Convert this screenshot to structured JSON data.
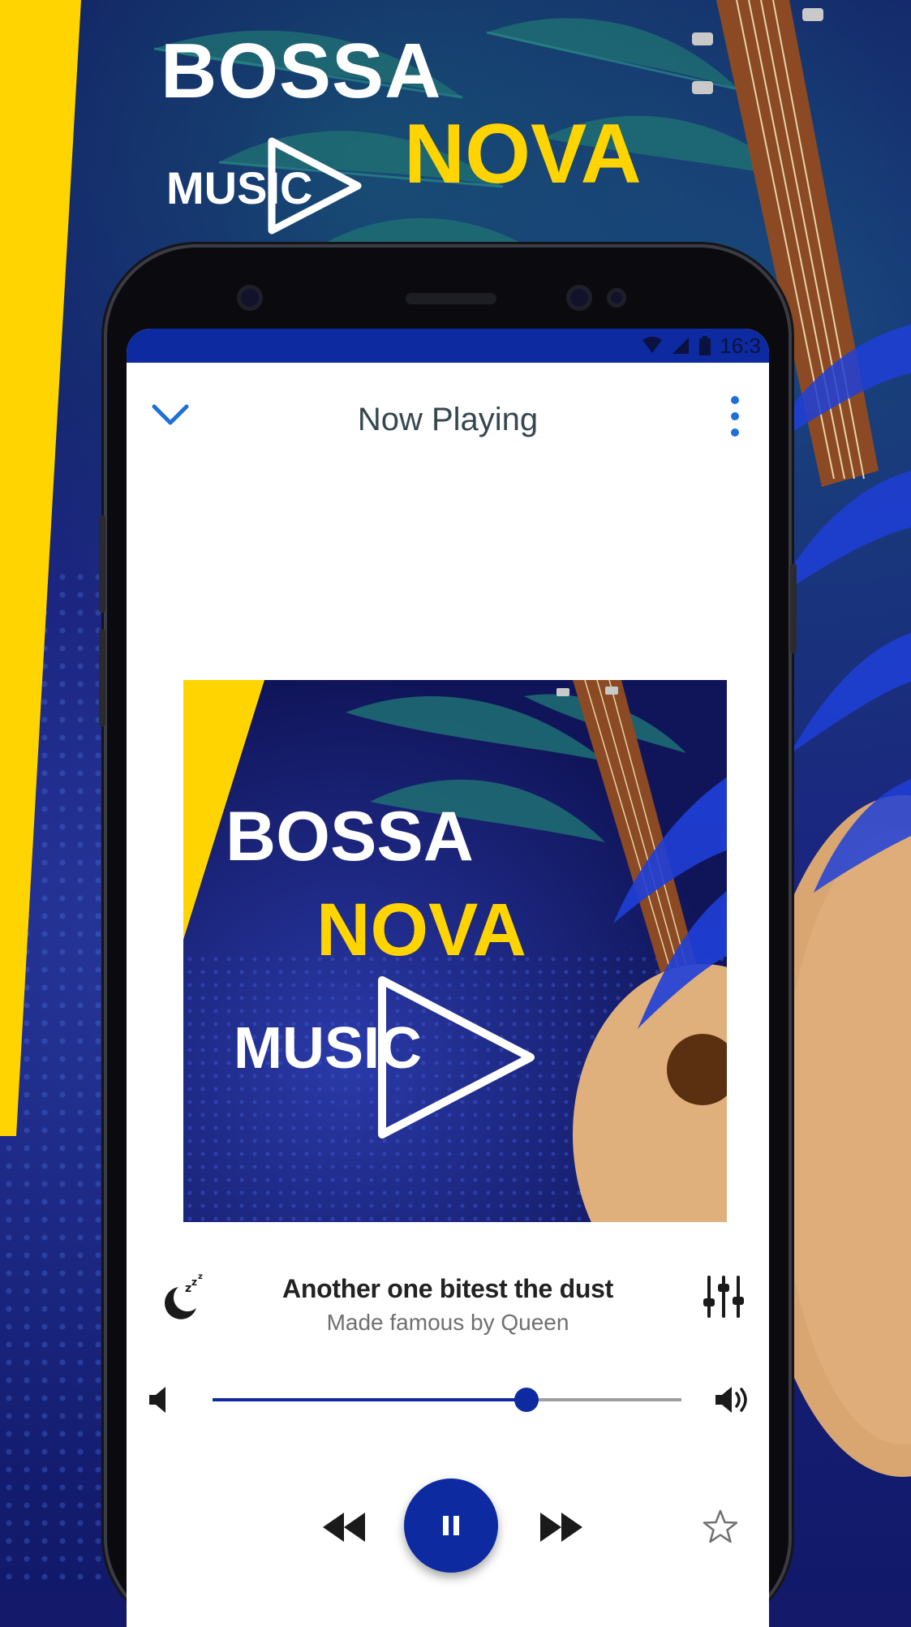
{
  "promo": {
    "title_line1": "BOSSA",
    "title_line2": "NOVA",
    "music_label": "MUSIC"
  },
  "status_bar": {
    "time": "16:3"
  },
  "app_bar": {
    "title": "Now Playing",
    "back_icon": "chevron-down-icon",
    "menu_icon": "more-vertical-icon"
  },
  "album_art": {
    "title_line1": "BOSSA",
    "title_line2": "NOVA",
    "music_label": "MUSIC"
  },
  "track": {
    "title": "Another one bitest the dust",
    "subtitle": "Made famous by Queen"
  },
  "volume": {
    "level": 0.67
  },
  "colors": {
    "accent": "#0d2aa0",
    "yellow": "#ffd400",
    "background": "#14196a"
  },
  "controls": {
    "sleep_icon": "sleep-timer-icon",
    "equalizer_icon": "equalizer-icon",
    "previous_icon": "rewind-icon",
    "play_pause_icon": "pause-icon",
    "next_icon": "fast-forward-icon",
    "favorite_icon": "star-outline-icon"
  }
}
